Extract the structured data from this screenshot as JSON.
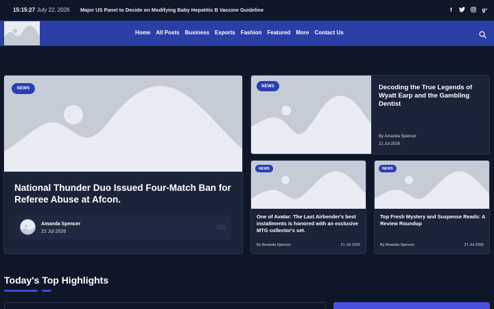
{
  "topbar": {
    "time": "15:15:27",
    "date": "July 22, 2026",
    "ticker": "Major US Panel to Decide on Modifying Baby Hepatitis B Vaccine Guideline",
    "socials": [
      "facebook-icon",
      "twitter-icon",
      "instagram-icon",
      "google-plus-icon"
    ]
  },
  "nav": {
    "items": [
      "Home",
      "All Posts",
      "Business",
      "Esports",
      "Fashion",
      "Featured",
      "More",
      "Contact Us"
    ]
  },
  "featured": {
    "badge": "NEWS",
    "title": "National Thunder Duo Issued Four-Match Ban for Referee Abuse at Afcon.",
    "author": "Amanda Spencer",
    "date": "22 Jul 2026"
  },
  "side_top": {
    "badge": "NEWS",
    "title": "Decoding the True Legends of Wyatt Earp and the Gambling Dentist",
    "author": "By Amanda Spencer",
    "date": "21 Jul 2026"
  },
  "small_cards": [
    {
      "badge": "NEWS",
      "title": "One of Avatar: The Last Airbender's best installments is honored with an exclusive MTG collector's set.",
      "author": "By Amanda Spencer",
      "date": "21 Jul 2026"
    },
    {
      "badge": "NEWS",
      "title": "Top Fresh Mystery and Suspense Reads: A Review Roundup",
      "author": "By Amanda Spencer",
      "date": "21 Jul 2026"
    }
  ],
  "section": {
    "title": "Today's Top Highlights"
  },
  "colors": {
    "background": "#0f1628",
    "nav": "#2a3fa6",
    "card": "#1b2338",
    "accent": "#3a4fd0"
  }
}
